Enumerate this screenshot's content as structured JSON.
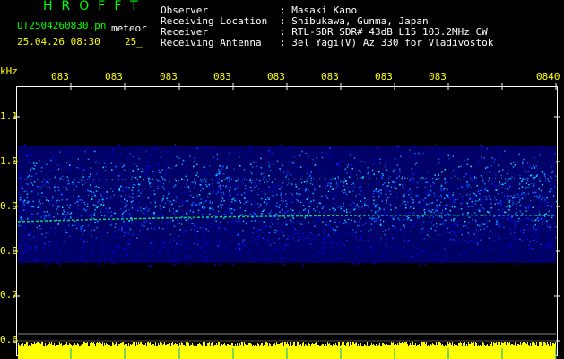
{
  "header": {
    "app_name": "HROFFT",
    "file_name": "UT2504260830.pn",
    "mode": "meteor",
    "datetime": "25.04.26 08:30",
    "index": "25_",
    "fields": [
      {
        "label": "Observer",
        "value": ": Masaki Kano"
      },
      {
        "label": "Receiving Location",
        "value": ": Shibukawa, Gunma, Japan"
      },
      {
        "label": "Receiver",
        "value": ": RTL-SDR SDR# 43dB L15 103.2MHz CW"
      },
      {
        "label": "Receiving Antenna",
        "value": ": 3el Yagi(V) Az 330 for Vladivostok"
      }
    ]
  },
  "plot": {
    "y_unit": "kHz",
    "y_ticks": [
      "1.1",
      "1.0",
      "0.9",
      "0.8",
      "0.7",
      "0.6"
    ],
    "time_ticks": [
      "083",
      "083",
      "083",
      "083",
      "083",
      "083",
      "083",
      "083",
      "0840"
    ],
    "colors": {
      "frame": "#ffffff",
      "grid": "#cccc00",
      "noise": "#0000ff",
      "band": "#00ccff",
      "trace": "#00ff66",
      "bar": "#ffff00"
    }
  }
}
